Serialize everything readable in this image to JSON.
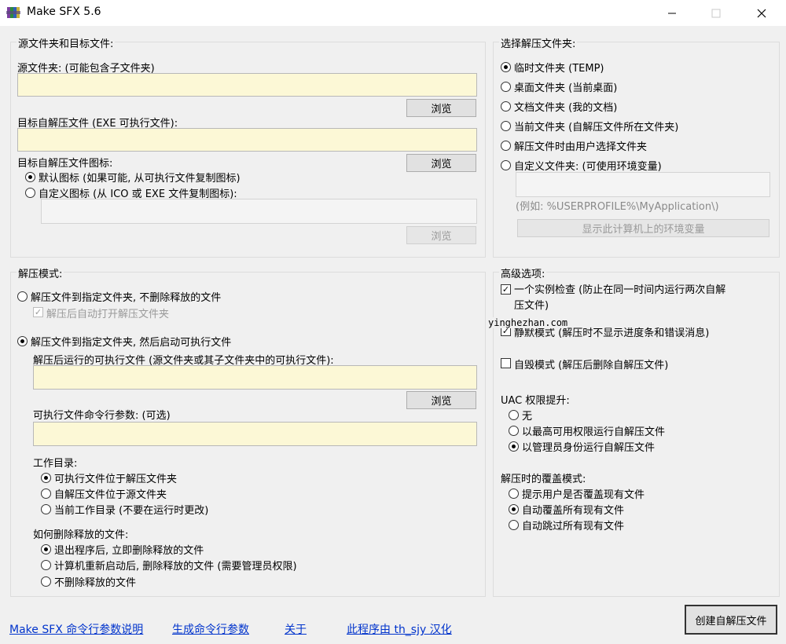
{
  "window": {
    "title": "Make SFX 5.6"
  },
  "source_group": {
    "title": "源文件夹和目标文件:",
    "source_label": "源文件夹: (可能包含子文件夹)",
    "source_value": "",
    "browse1": "浏览",
    "target_label": "目标自解压文件 (EXE 可执行文件):",
    "target_value": "",
    "icon_label": "目标自解压文件图标:",
    "browse2": "浏览",
    "icon_default": "默认图标 (如果可能, 从可执行文件复制图标)",
    "icon_custom": "自定义图标 (从 ICO 或 EXE 文件复制图标):",
    "icon_path_value": "",
    "browse3": "浏览"
  },
  "extract_group": {
    "title": "选择解压文件夹:",
    "options": [
      "临时文件夹 (TEMP)",
      "桌面文件夹 (当前桌面)",
      "文档文件夹 (我的文档)",
      "当前文件夹 (自解压文件所在文件夹)",
      "解压文件时由用户选择文件夹",
      "自定义文件夹: (可使用环境变量)"
    ],
    "selected": 0,
    "custom_value": "",
    "example": "(例如: %USERPROFILE%\\MyApplication\\)",
    "env_button": "显示此计算机上的环境变量"
  },
  "mode_group": {
    "title": "解压模式:",
    "mode1": "解压文件到指定文件夹, 不删除释放的文件",
    "auto_open": "解压后自动打开解压文件夹",
    "mode2": "解压文件到指定文件夹, 然后启动可执行文件",
    "exe_label": "解压后运行的可执行文件 (源文件夹或其子文件夹中的可执行文件):",
    "exe_value": "",
    "browse4": "浏览",
    "args_label": "可执行文件命令行参数: (可选)",
    "args_value": "",
    "workdir_label": "工作目录:",
    "workdir_options": [
      "可执行文件位于解压文件夹",
      "自解压文件位于源文件夹",
      "当前工作目录 (不要在运行时更改)"
    ],
    "delete_label": "如何删除释放的文件:",
    "delete_options": [
      "退出程序后, 立即删除释放的文件",
      "计算机重新启动后, 删除释放的文件 (需要管理员权限)",
      "不删除释放的文件"
    ]
  },
  "advanced_group": {
    "title": "高级选项:",
    "single_instance_line1": "一个实例检查 (防止在同一时间内运行两次自解",
    "single_instance_line2": "压文件)",
    "silent": "静默模式 (解压时不显示进度条和错误消息)",
    "self_delete": "自毁模式 (解压后删除自解压文件)",
    "uac_label": "UAC 权限提升:",
    "uac_options": [
      "无",
      "以最高可用权限运行自解压文件",
      "以管理员身份运行自解压文件"
    ],
    "overwrite_label": "解压时的覆盖模式:",
    "overwrite_options": [
      "提示用户是否覆盖现有文件",
      "自动覆盖所有现有文件",
      "自动跳过所有现有文件"
    ]
  },
  "watermark": "yinghezhan.com",
  "footer": {
    "link1": "Make SFX 命令行参数说明",
    "link2": "生成命令行参数",
    "link3": "关于",
    "link4": "此程序由 th_sjy 汉化",
    "create_button": "创建自解压文件"
  },
  "icons": {
    "app": "winrar-books-icon",
    "minimize": "minimize-icon",
    "maximize": "maximize-icon",
    "close": "close-icon"
  }
}
